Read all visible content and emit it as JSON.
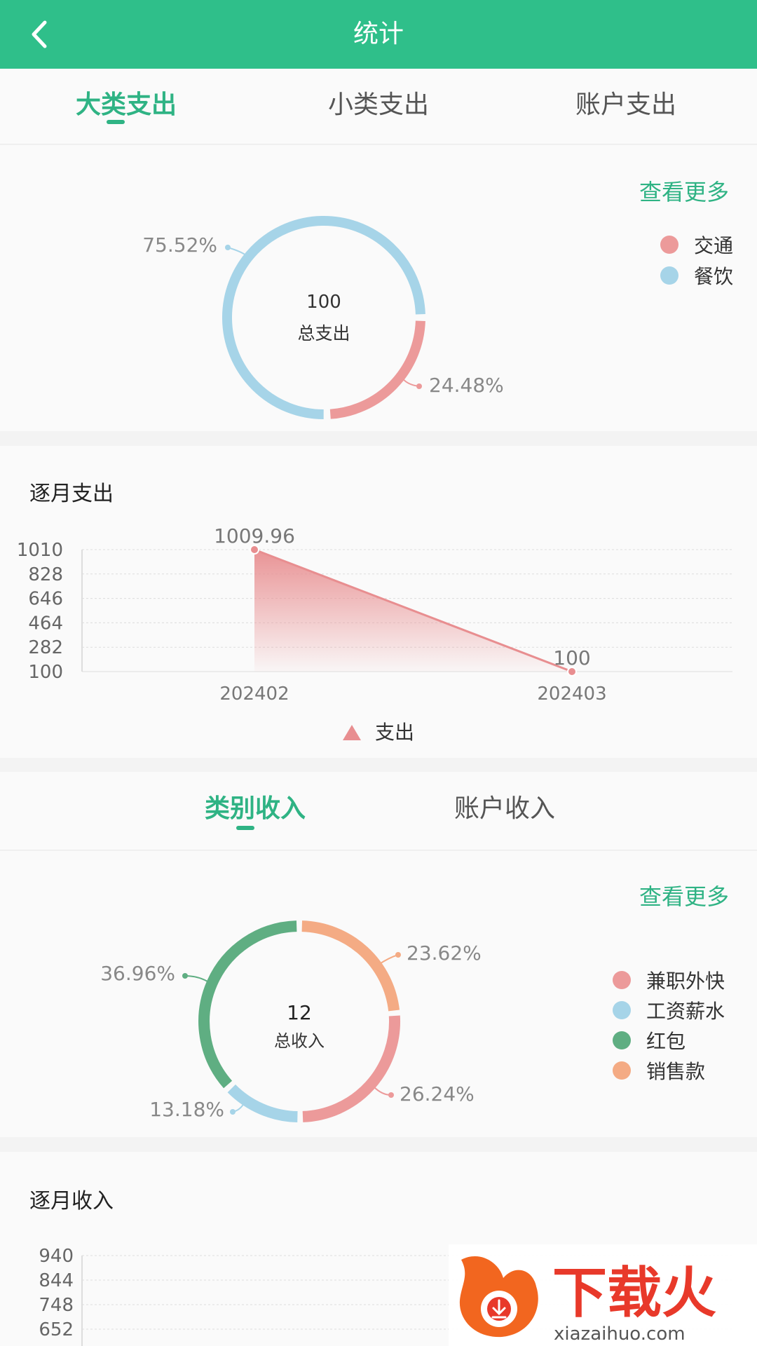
{
  "app_bar": {
    "title": "统计",
    "back_icon": "chevron-left-icon"
  },
  "expense_tabs": [
    {
      "label": "大类支出",
      "active": true
    },
    {
      "label": "小类支出",
      "active": false
    },
    {
      "label": "账户支出",
      "active": false
    }
  ],
  "expense_pie": {
    "more_label": "查看更多",
    "center_value": "100",
    "center_label": "总支出",
    "legend": [
      {
        "label": "交通",
        "color": "#ec9a9a"
      },
      {
        "label": "餐饮",
        "color": "#a6d4e8"
      }
    ],
    "label_traffic": "24.48%",
    "label_food": "75.52%"
  },
  "monthly_expense": {
    "title": "逐月支出",
    "legend_label": "支出",
    "legend_icon": "triangle-icon"
  },
  "income_tabs": [
    {
      "label": "类别收入",
      "active": true
    },
    {
      "label": "账户收入",
      "active": false
    }
  ],
  "income_pie": {
    "more_label": "查看更多",
    "center_value": "12",
    "center_label": "总收入",
    "legend": [
      {
        "label": "兼职外快",
        "color": "#ec9a9a"
      },
      {
        "label": "工资薪水",
        "color": "#a6d4e8"
      },
      {
        "label": "红包",
        "color": "#5fae82"
      },
      {
        "label": "销售款",
        "color": "#f4ab84"
      }
    ],
    "label_parttime": "26.24%",
    "label_salary": "13.18%",
    "label_redpacket": "36.96%",
    "label_sales": "23.62%"
  },
  "monthly_income": {
    "title": "逐月收入",
    "y_ticks": [
      "940",
      "844",
      "748",
      "652"
    ]
  },
  "watermark": {
    "text_cn": "下载火",
    "text_en": "xiazaihuo.com"
  },
  "chart_data": [
    {
      "type": "pie",
      "center_text": "100 总支出",
      "categories": [
        "交通",
        "餐饮"
      ],
      "values": [
        24.48,
        75.52
      ],
      "colors": [
        "#ec9a9a",
        "#a6d4e8"
      ]
    },
    {
      "type": "area",
      "title": "逐月支出",
      "categories": [
        "202402",
        "202403"
      ],
      "series": [
        {
          "name": "支出",
          "values": [
            1009.96,
            100
          ]
        }
      ],
      "y_ticks": [
        1010,
        828,
        646,
        464,
        282,
        100
      ],
      "ylim": [
        100,
        1010
      ],
      "grid": true,
      "legend": "bottom"
    },
    {
      "type": "pie",
      "center_text": "12 总收入",
      "categories": [
        "兼职外快",
        "工资薪水",
        "红包",
        "销售款"
      ],
      "values": [
        26.24,
        13.18,
        36.96,
        23.62
      ],
      "colors": [
        "#ec9a9a",
        "#a6d4e8",
        "#5fae82",
        "#f4ab84"
      ]
    },
    {
      "type": "area",
      "title": "逐月收入",
      "y_ticks": [
        940,
        844,
        748,
        652
      ],
      "grid": true
    }
  ]
}
